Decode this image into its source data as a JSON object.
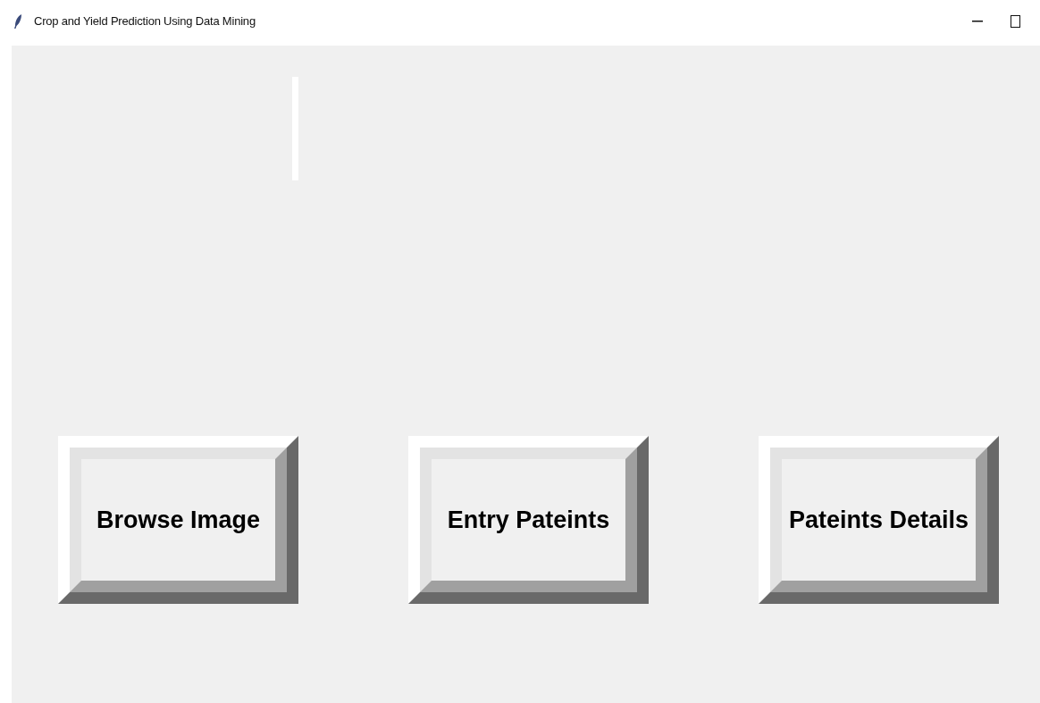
{
  "window": {
    "title": "Crop and Yield Prediction Using Data Mining"
  },
  "buttons": [
    {
      "label": "Browse Image"
    },
    {
      "label": "Entry Pateints"
    },
    {
      "label": "Pateints Details"
    }
  ]
}
